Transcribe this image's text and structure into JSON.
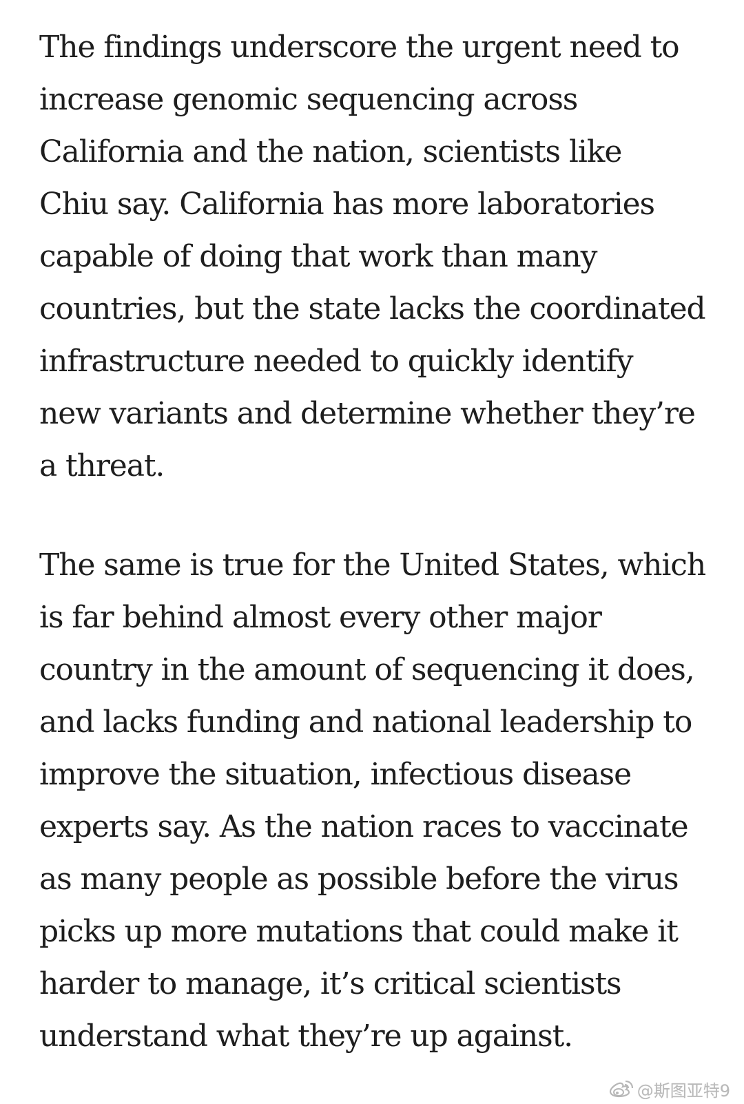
{
  "article": {
    "paragraphs": [
      {
        "lines": [
          "The findings underscore the urgent need to",
          "increase genomic sequencing across",
          "California and the nation, scientists like",
          "Chiu say. California has more laboratories",
          "capable of doing that work than many",
          "countries, but the state lacks the coordinated",
          "infrastructure needed to quickly identify",
          "new variants and determine whether they’re",
          "a threat."
        ]
      },
      {
        "lines": [
          "The same is true for the United States, which",
          "is far behind almost every other major",
          "country in the amount of sequencing it does,",
          "and lacks funding and national leadership to",
          "improve the situation, infectious disease",
          "experts say. As the nation races to vaccinate",
          "as many people as possible before the virus",
          "picks up more mutations that could make it",
          "harder to manage, it’s critical scientists",
          "understand what they’re up against."
        ]
      }
    ]
  },
  "watermark": {
    "icon": "weibo-icon",
    "text": "@斯图亚特9"
  }
}
